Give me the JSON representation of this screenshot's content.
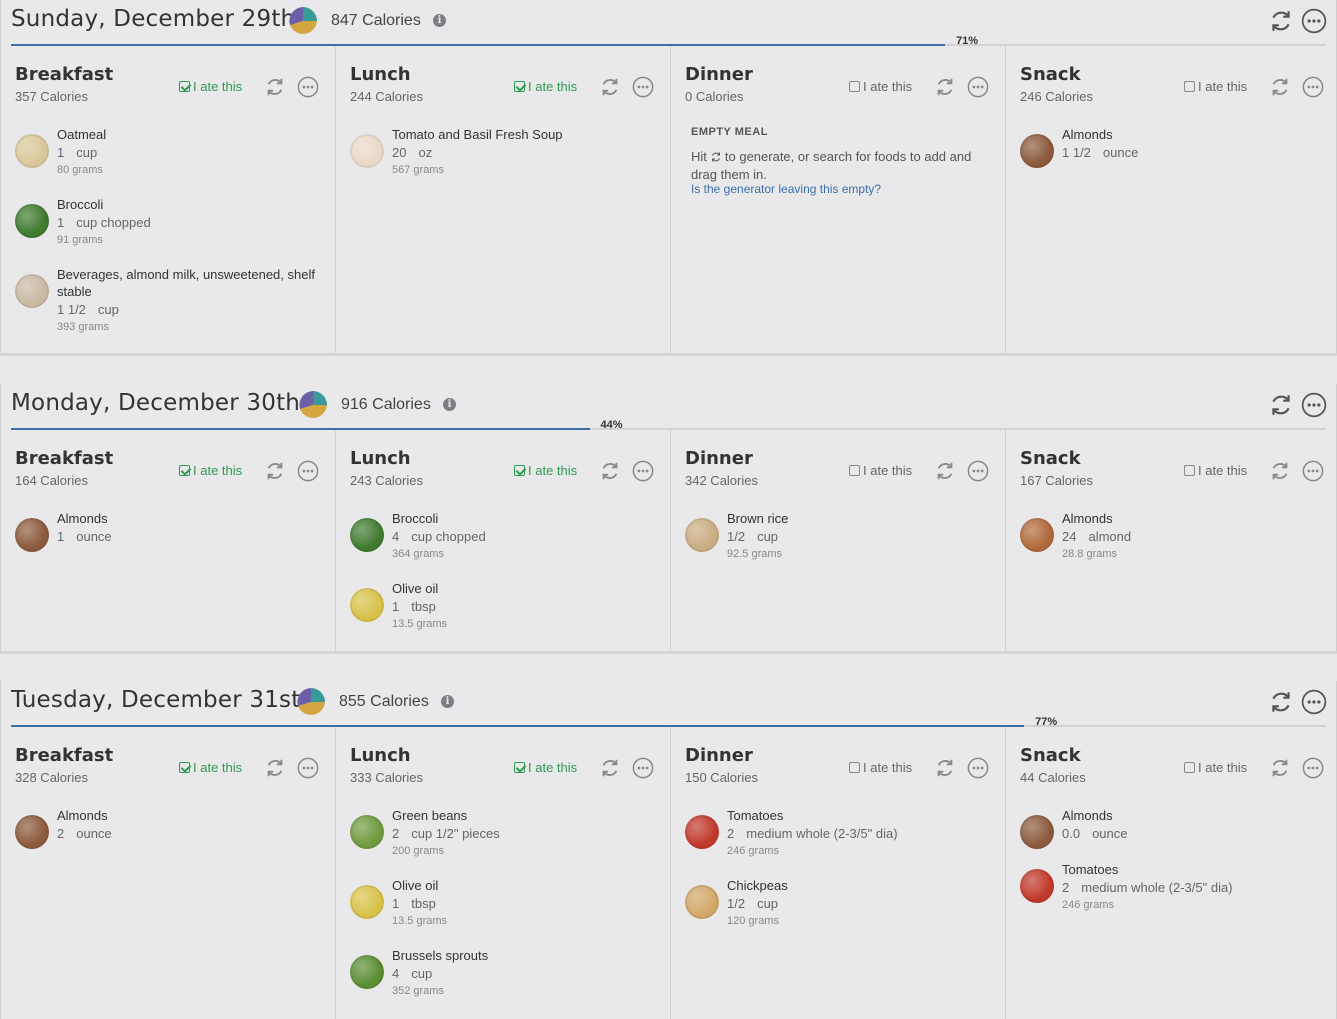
{
  "days": [
    {
      "title": "Sunday, December 29th",
      "calories": "847 Calories",
      "progress_pct": 71,
      "progress_label": "71%",
      "meals": [
        {
          "name": "Breakfast",
          "calories": "357 Calories",
          "ate": true,
          "ate_label": "I ate this",
          "foods": [
            {
              "name": "Oatmeal",
              "qty": "1",
              "unit": "cup",
              "grams": "80 grams",
              "icon": "oatmeal-icon",
              "color": "#d9c79a"
            },
            {
              "name": "Broccoli",
              "qty": "1",
              "unit": "cup chopped",
              "grams": "91 grams",
              "icon": "broccoli-icon",
              "color": "#3f7a2e"
            },
            {
              "name": "Beverages, almond milk, unsweetened, shelf stable",
              "qty": "1 1/2",
              "unit": "cup",
              "grams": "393 grams",
              "icon": "almond-milk-icon",
              "color": "#c9b9a3"
            }
          ]
        },
        {
          "name": "Lunch",
          "calories": "244 Calories",
          "ate": true,
          "ate_label": "I ate this",
          "foods": [
            {
              "name": "Tomato and Basil Fresh Soup",
              "qty": "20",
              "unit": "oz",
              "grams": "567 grams",
              "icon": "carrot-icon",
              "color": "#e9d9c9"
            }
          ]
        },
        {
          "name": "Dinner",
          "calories": "0 Calories",
          "ate": false,
          "ate_label": "I ate this",
          "empty": {
            "title": "EMPTY MEAL",
            "text_before": "Hit",
            "text_after": "to generate, or search for foods to add and drag them in.",
            "link": "Is the generator leaving this empty?"
          },
          "foods": []
        },
        {
          "name": "Snack",
          "calories": "246 Calories",
          "ate": false,
          "ate_label": "I ate this",
          "foods": [
            {
              "name": "Almonds",
              "qty": "1 1/2",
              "unit": "ounce",
              "grams": "",
              "icon": "almonds-icon",
              "color": "#8b5a3c"
            }
          ]
        }
      ]
    },
    {
      "title": "Monday, December 30th",
      "calories": "916 Calories",
      "progress_pct": 44,
      "progress_label": "44%",
      "meals": [
        {
          "name": "Breakfast",
          "calories": "164 Calories",
          "ate": true,
          "ate_label": "I ate this",
          "foods": [
            {
              "name": "Almonds",
              "qty": "1",
              "unit": "ounce",
              "grams": "",
              "icon": "almonds-icon",
              "color": "#8b5a3c"
            }
          ]
        },
        {
          "name": "Lunch",
          "calories": "243 Calories",
          "ate": true,
          "ate_label": "I ate this",
          "foods": [
            {
              "name": "Broccoli",
              "qty": "4",
              "unit": "cup chopped",
              "grams": "364 grams",
              "icon": "broccoli-icon",
              "color": "#3f7a2e"
            },
            {
              "name": "Olive oil",
              "qty": "1",
              "unit": "tbsp",
              "grams": "13.5 grams",
              "icon": "olive-oil-icon",
              "color": "#d8c24a"
            }
          ]
        },
        {
          "name": "Dinner",
          "calories": "342 Calories",
          "ate": false,
          "ate_label": "I ate this",
          "foods": [
            {
              "name": "Brown rice",
              "qty": "1/2",
              "unit": "cup",
              "grams": "92.5 grams",
              "icon": "brown-rice-icon",
              "color": "#c8ad82"
            }
          ]
        },
        {
          "name": "Snack",
          "calories": "167 Calories",
          "ate": false,
          "ate_label": "I ate this",
          "foods": [
            {
              "name": "Almonds",
              "qty": "24",
              "unit": "almond",
              "grams": "28.8 grams",
              "icon": "almonds-icon",
              "color": "#b0683a"
            }
          ]
        }
      ]
    },
    {
      "title": "Tuesday, December 31st",
      "calories": "855 Calories",
      "progress_pct": 77,
      "progress_label": "77%",
      "meals": [
        {
          "name": "Breakfast",
          "calories": "328 Calories",
          "ate": true,
          "ate_label": "I ate this",
          "foods": [
            {
              "name": "Almonds",
              "qty": "2",
              "unit": "ounce",
              "grams": "",
              "icon": "almonds-icon",
              "color": "#8b5a3c"
            }
          ]
        },
        {
          "name": "Lunch",
          "calories": "333 Calories",
          "ate": true,
          "ate_label": "I ate this",
          "foods": [
            {
              "name": "Green beans",
              "qty": "2",
              "unit": "cup 1/2\" pieces",
              "grams": "200 grams",
              "icon": "green-beans-icon",
              "color": "#6f9a3e"
            },
            {
              "name": "Olive oil",
              "qty": "1",
              "unit": "tbsp",
              "grams": "13.5 grams",
              "icon": "olive-oil-icon",
              "color": "#d8c24a"
            },
            {
              "name": "Brussels sprouts",
              "qty": "4",
              "unit": "cup",
              "grams": "352 grams",
              "icon": "brussels-sprouts-icon",
              "color": "#5a8d34"
            }
          ]
        },
        {
          "name": "Dinner",
          "calories": "150 Calories",
          "ate": false,
          "ate_label": "I ate this",
          "foods": [
            {
              "name": "Tomatoes",
              "qty": "2",
              "unit": "medium whole (2-3/5\" dia)",
              "grams": "246 grams",
              "icon": "tomato-icon",
              "color": "#c0392b"
            },
            {
              "name": "Chickpeas",
              "qty": "1/2",
              "unit": "cup",
              "grams": "120 grams",
              "icon": "chickpeas-icon",
              "color": "#d1a766"
            }
          ]
        },
        {
          "name": "Snack",
          "calories": "44 Calories",
          "ate": false,
          "ate_label": "I ate this",
          "foods": [
            {
              "name": "Almonds",
              "qty": "0.0",
              "unit": "ounce",
              "grams": "",
              "icon": "almonds-icon",
              "color": "#8b5a3c"
            },
            {
              "name": "Tomatoes",
              "qty": "2",
              "unit": "medium whole (2-3/5\" dia)",
              "grams": "246 grams",
              "icon": "tomato-icon",
              "color": "#c0392b"
            }
          ]
        }
      ]
    }
  ],
  "colors": {
    "accent": "#3c6ea8",
    "ate": "#2f9a52",
    "pie_purple": "#6b5fa8",
    "pie_teal": "#3a9a9a",
    "pie_gold": "#d4a640"
  }
}
